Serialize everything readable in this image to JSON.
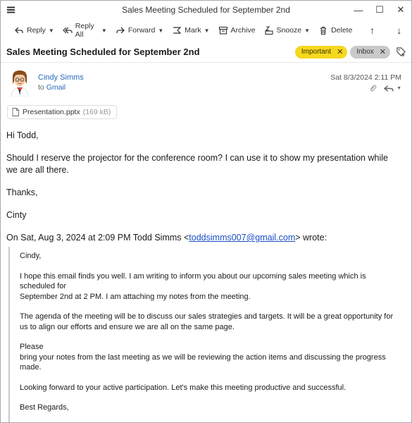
{
  "window": {
    "title": "Sales Meeting Scheduled for September 2nd",
    "controls": {
      "minimize": "—",
      "maximize": "☐",
      "close": "✕"
    }
  },
  "toolbar": {
    "reply": "Reply",
    "reply_all": "Reply All",
    "forward": "Forward",
    "mark": "Mark",
    "archive": "Archive",
    "snooze": "Snooze",
    "delete": "Delete",
    "up": "↑",
    "down": "↓"
  },
  "message": {
    "subject": "Sales Meeting Scheduled for September 2nd",
    "tags": [
      {
        "label": "Important",
        "color": "#f6d81e"
      },
      {
        "label": "Inbox",
        "color": "#c9c9c9"
      }
    ],
    "from_name": "Cindy Simms",
    "to_prefix": "to",
    "to": "Gmail",
    "date": "Sat 8/3/2024 2:11 PM",
    "attachment": {
      "name": "Presentation.pptx",
      "size": "(169 kB)"
    },
    "body": {
      "greeting": "Hi Todd,",
      "paragraph": "Should I reserve the projector for the conference room? I can use it to show my presentation while we are all there.",
      "closing": "Thanks,",
      "signature": "Cinty",
      "quote_header_prefix": "On Sat, Aug 3, 2024 at 2:09 PM Todd Simms <",
      "quote_header_email": "toddsimms007@gmail.com",
      "quote_header_suffix": "> wrote:"
    },
    "quote": {
      "salutation": "Cindy,",
      "p1": "I hope this email finds you well. I am writing to inform you about our upcoming sales meeting which is scheduled for\nSeptember 2nd at 2 PM. I am attaching my notes from the meeting.",
      "p2": "The agenda of the meeting will be to discuss our sales strategies and targets. It will be a great opportunity for us to align our efforts and ensure we are all on the same page.",
      "p3": "Please\nbring your notes from the last meeting as we will be reviewing the action items and discussing the progress made.",
      "p4": "Looking forward to your active participation. Let's make this meeting productive and successful.",
      "signoff": "Best Regards,"
    }
  },
  "colors": {
    "link": "#2a6ab8",
    "important_tag": "#f6d81e",
    "inbox_tag": "#c9c9c9"
  },
  "icons": [
    "menu-icon",
    "reply-icon",
    "reply-all-icon",
    "forward-icon",
    "mark-icon",
    "archive-icon",
    "snooze-icon",
    "delete-icon",
    "tag-add-icon",
    "attachment-paperclip-icon",
    "reply-arrow-icon",
    "file-icon"
  ]
}
